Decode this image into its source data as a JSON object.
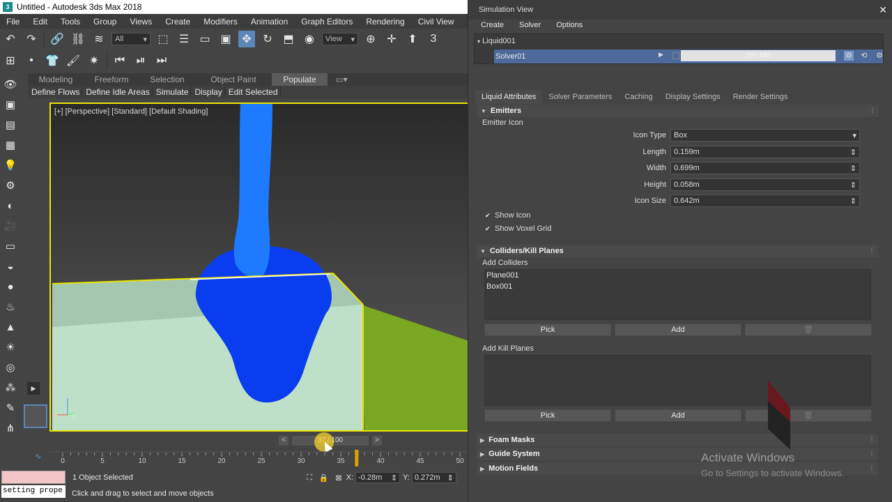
{
  "window": {
    "title": "Untitled - Autodesk 3ds Max 2018"
  },
  "menubar": [
    "File",
    "Edit",
    "Tools",
    "Group",
    "Views",
    "Create",
    "Modifiers",
    "Animation",
    "Graph Editors",
    "Rendering",
    "Civil View"
  ],
  "toolbar": {
    "selection_filter": "All",
    "reference_coord": "View"
  },
  "ribbon": {
    "tabs": [
      "Modeling",
      "Freeform",
      "Selection",
      "Object Paint",
      "Populate"
    ],
    "active_tab": "Populate",
    "commands": [
      "Define Flows",
      "Define Idle Areas",
      "Simulate",
      "Display",
      "Edit Selected"
    ]
  },
  "viewport": {
    "label": "[+] [Perspective] [Standard] [Default Shading]",
    "axis_x": "x",
    "axis_y": "y",
    "axis_z": "z",
    "colors": {
      "liquid": "#0a3cf0",
      "liquid_stream": "#1e7bff",
      "container": "#bfe0c8",
      "ground": "#7aa823",
      "selection": "#e9e400"
    }
  },
  "timeline": {
    "frame_display": "37 / 100",
    "prev": "<",
    "next": ">",
    "ticks": [
      "0",
      "5",
      "10",
      "15",
      "20",
      "25",
      "30",
      "35",
      "40",
      "45",
      "50"
    ],
    "current_frame": 37
  },
  "status": {
    "maxscript_text": "setting prope",
    "selection": "1 Object Selected",
    "prompt": "Click and drag to select and move objects",
    "x_label": "X:",
    "x_value": "-0.28m",
    "y_label": "Y:",
    "y_value": "0.272m"
  },
  "sim": {
    "title": "Simulation View",
    "menu": [
      "Create",
      "Solver",
      "Options"
    ],
    "tree_root": "Liquid001",
    "tree_child": "Solver01",
    "progress_text": "Sim Idle",
    "tabs": [
      "Liquid Attributes",
      "Solver Parameters",
      "Caching",
      "Display Settings",
      "Render Settings"
    ],
    "active_tab": "Liquid Attributes",
    "emitters": {
      "title": "Emitters",
      "sublabel": "Emitter Icon",
      "fields": [
        {
          "label": "Icon Type",
          "value": "Box",
          "kind": "dropdown"
        },
        {
          "label": "Length",
          "value": "0.159m",
          "kind": "spinner"
        },
        {
          "label": "Width",
          "value": "0.699m",
          "kind": "spinner"
        },
        {
          "label": "Height",
          "value": "0.058m",
          "kind": "spinner"
        },
        {
          "label": "Icon Size",
          "value": "0.642m",
          "kind": "spinner"
        }
      ],
      "show_icon": "Show Icon",
      "show_voxel": "Show Voxel Grid"
    },
    "colliders": {
      "title": "Colliders/Kill Planes",
      "add_colliders": "Add Colliders",
      "collider_items": [
        "Plane001",
        "Box001"
      ],
      "pick": "Pick",
      "add": "Add",
      "add_kill_planes": "Add Kill Planes"
    },
    "collapsed_sections": [
      "Foam Masks",
      "Guide System",
      "Motion Fields"
    ]
  },
  "watermark": {
    "line1": "Activate Windows",
    "line2": "Go to Settings to activate Windows."
  }
}
